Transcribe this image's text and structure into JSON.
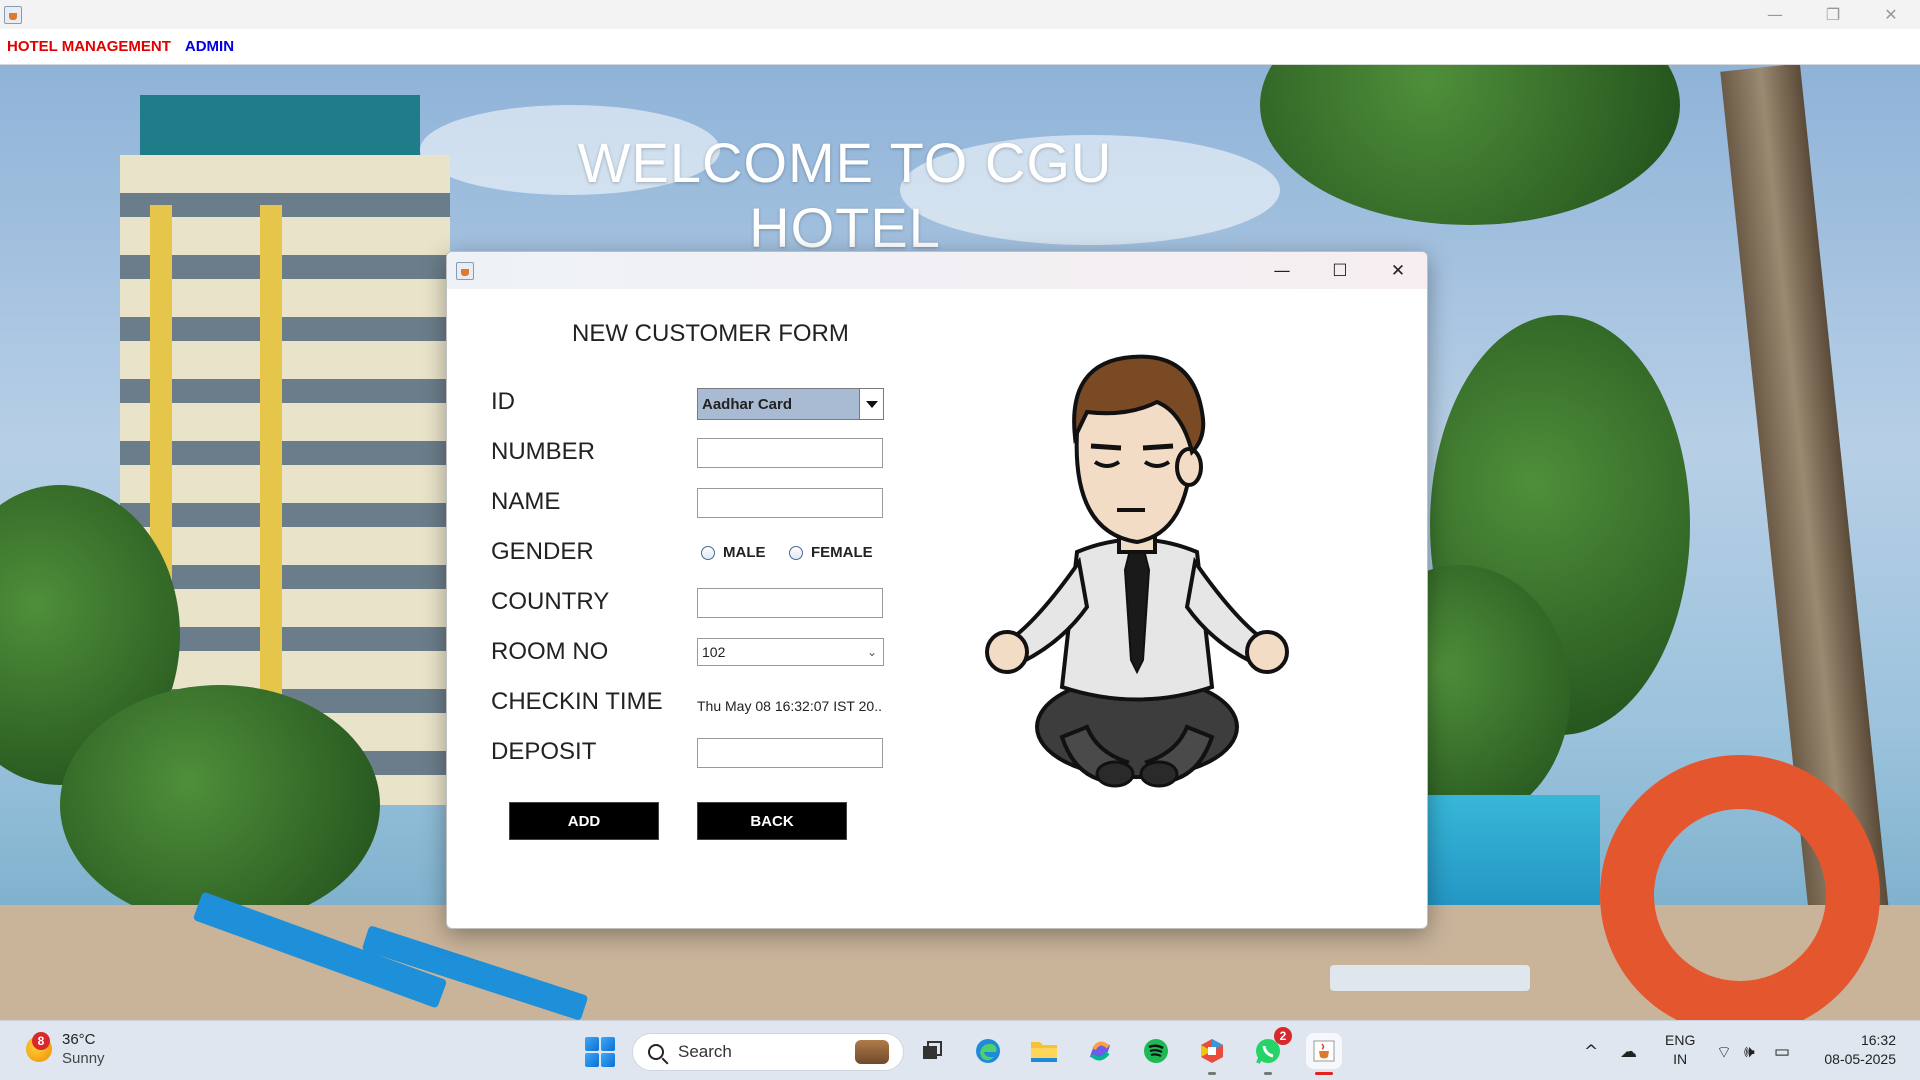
{
  "window": {
    "minimize_glyph": "—",
    "restore_glyph": "❐",
    "close_glyph": "✕"
  },
  "menubar": {
    "items": [
      {
        "label": "HOTEL MANAGEMENT",
        "color": "#e00000"
      },
      {
        "label": "ADMIN",
        "color": "#0000e0"
      }
    ]
  },
  "background": {
    "welcome_text": "WELCOME TO CGU HOTEL"
  },
  "dialog": {
    "minimize_glyph": "—",
    "maximize_glyph": "☐",
    "close_glyph": "✕",
    "form_title": "NEW CUSTOMER FORM",
    "fields": {
      "id": {
        "label": "ID",
        "selected": "Aadhar Card"
      },
      "number": {
        "label": "NUMBER",
        "value": ""
      },
      "name": {
        "label": "NAME",
        "value": ""
      },
      "gender": {
        "label": "GENDER",
        "options": [
          "MALE",
          "FEMALE"
        ],
        "selected": null
      },
      "country": {
        "label": "COUNTRY",
        "value": ""
      },
      "room_no": {
        "label": "ROOM NO",
        "selected": "102"
      },
      "checkin_time": {
        "label": "CHECKIN TIME",
        "value": "Thu May 08 16:32:07 IST 20.."
      },
      "deposit": {
        "label": "DEPOSIT",
        "value": ""
      }
    },
    "buttons": {
      "add": "ADD",
      "back": "BACK"
    },
    "illustration": "meditating-businessman-cartoon"
  },
  "taskbar": {
    "weather": {
      "badge": "8",
      "temperature": "36°C",
      "condition": "Sunny"
    },
    "search_placeholder": "Search",
    "apps": [
      "task-view",
      "edge",
      "file-explorer",
      "copilot",
      "spotify",
      "office-hub",
      "whatsapp",
      "java"
    ],
    "whatsapp_badge": "2",
    "tray": {
      "language": "ENG",
      "region": "IN",
      "time": "16:32",
      "date": "08-05-2025",
      "chevron_glyph": "^"
    }
  },
  "colors": {
    "menu_hotel": "#e00000",
    "menu_admin": "#0000e0",
    "button_bg": "#000000",
    "id_combo_bg": "#a9bad3"
  }
}
